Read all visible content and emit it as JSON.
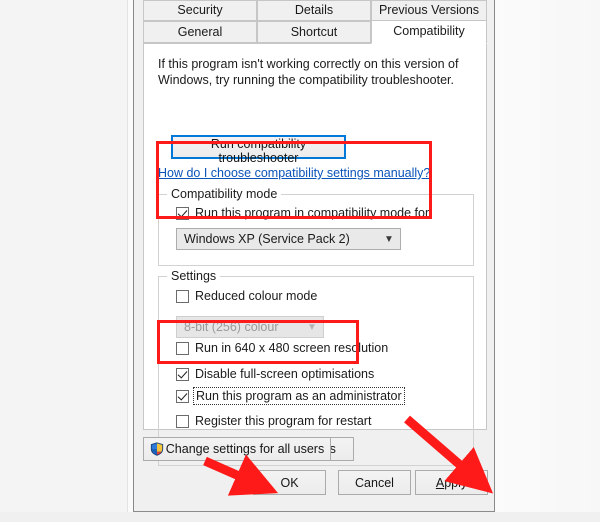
{
  "dialog": {
    "tabs_row1": [
      {
        "label": "Security",
        "active": false
      },
      {
        "label": "Details",
        "active": false
      },
      {
        "label": "Previous Versions",
        "active": false
      }
    ],
    "tabs_row2": [
      {
        "label": "General",
        "active": false
      },
      {
        "label": "Shortcut",
        "active": false
      },
      {
        "label": "Compatibility",
        "active": true
      }
    ],
    "intro_text": "If this program isn't working correctly on this version of Windows, try running the compatibility troubleshooter.",
    "troubleshoot_button": "Run compatibility troubleshooter",
    "help_link": "How do I choose compatibility settings manually?",
    "compatibility_mode": {
      "group_title": "Compatibility mode",
      "checkbox_label": "Run this program in compatibility mode for:",
      "checkbox_checked": true,
      "selected_os": "Windows XP (Service Pack 2)",
      "dropdown_icon": "chevron-down-icon"
    },
    "settings": {
      "group_title": "Settings",
      "reduced_colour": {
        "label": "Reduced colour mode",
        "checked": false
      },
      "colour_depth": {
        "value": "8-bit (256) colour",
        "disabled": true,
        "dropdown_icon": "chevron-down-icon"
      },
      "low_resolution": {
        "label": "Run in 640 x 480 screen resolution",
        "checked": false
      },
      "disable_fullscreen": {
        "label": "Disable full-screen optimisations",
        "checked": true
      },
      "run_as_admin": {
        "label": "Run this program as an administrator",
        "checked": true,
        "focused": true
      },
      "register_restart": {
        "label": "Register this program for restart",
        "checked": false
      },
      "dpi_button": "Change high DPI settings"
    },
    "all_users_button": {
      "label": "Change settings for all users",
      "icon": "uac-shield-icon"
    },
    "footer": {
      "ok": "OK",
      "cancel": "Cancel",
      "apply_prefix": "A",
      "apply_rest": "pply"
    }
  },
  "annotations": {
    "colors": {
      "highlight": "#ff1a1a"
    },
    "boxes": [
      {
        "name": "compatibility-mode-highlight"
      },
      {
        "name": "checkbox-pair-highlight"
      }
    ],
    "arrows": [
      {
        "name": "ok-button-arrow"
      },
      {
        "name": "apply-button-arrow"
      }
    ]
  }
}
